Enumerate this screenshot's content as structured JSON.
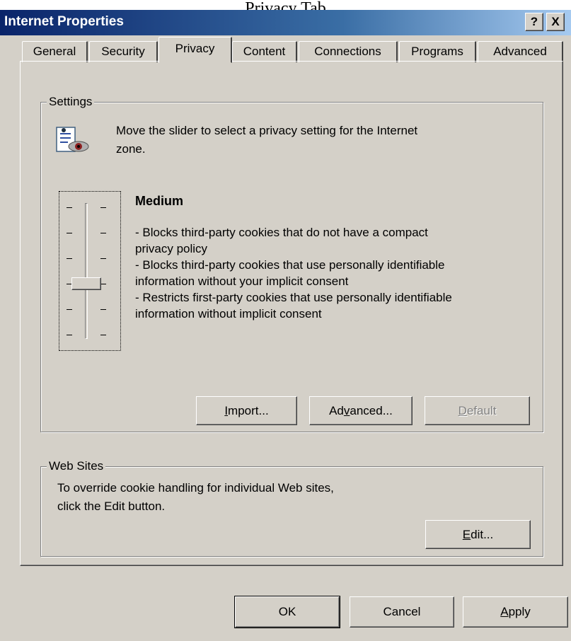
{
  "caption_text": "Privacy Tab",
  "window": {
    "title": "Internet Properties",
    "help_glyph": "?",
    "close_glyph": "X"
  },
  "tabs": [
    "General",
    "Security",
    "Privacy",
    "Content",
    "Connections",
    "Programs",
    "Advanced"
  ],
  "active_tab": "Privacy",
  "settings": {
    "legend": "Settings",
    "icon": "privacy-eye-icon",
    "instruction_line1": "Move the slider to select a privacy setting for the Internet",
    "instruction_line2": "zone.",
    "slider": {
      "ticks": 6,
      "selected_level_index": 3,
      "selected_level_fraction_from_top": 0.6
    },
    "level_name": "Medium",
    "description_lines": [
      "- Blocks third-party cookies that do not have a compact",
      "privacy policy",
      "- Blocks third-party cookies that use personally identifiable",
      "information without your implicit consent",
      "- Restricts first-party cookies that use personally identifiable",
      "information without implicit consent"
    ],
    "buttons": {
      "import": {
        "pre": "",
        "key": "I",
        "post": "mport..."
      },
      "advanced": {
        "pre": "Ad",
        "key": "v",
        "post": "anced..."
      },
      "default": {
        "pre": "",
        "key": "D",
        "post": "efault",
        "enabled": false
      }
    }
  },
  "web_sites": {
    "legend": "Web Sites",
    "line1": "To override cookie handling for individual Web sites,",
    "line2": "click the Edit button.",
    "edit_button": {
      "pre": "",
      "key": "E",
      "post": "dit..."
    }
  },
  "footer": {
    "ok": "OK",
    "cancel": "Cancel",
    "apply": {
      "pre": "",
      "key": "A",
      "post": "pply"
    }
  },
  "colors": {
    "face": "#d4d0c8",
    "title_start": "#0a246a",
    "title_end": "#a6caf0",
    "shadow": "#808080"
  }
}
